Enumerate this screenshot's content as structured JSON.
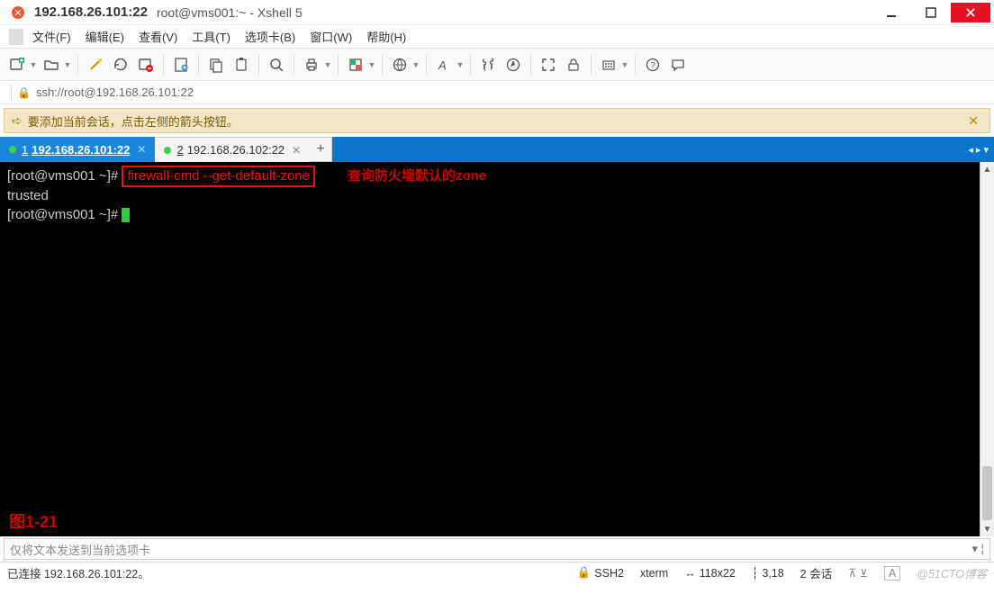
{
  "title": {
    "main": "192.168.26.101:22",
    "sub": "root@vms001:~ - Xshell 5"
  },
  "menu": {
    "file": "文件(F)",
    "edit": "编辑(E)",
    "view": "查看(V)",
    "tools": "工具(T)",
    "tabs": "选项卡(B)",
    "window": "窗口(W)",
    "help": "帮助(H)"
  },
  "address": {
    "url": "ssh://root@192.168.26.101:22"
  },
  "infobar": {
    "text": "要添加当前会话，点击左侧的箭头按钮。"
  },
  "tabs": {
    "items": [
      {
        "n": "1",
        "label": "192.168.26.101:22",
        "active": true
      },
      {
        "n": "2",
        "label": "192.168.26.102:22",
        "active": false
      }
    ],
    "add": "+"
  },
  "terminal": {
    "prompt1": "[root@vms001 ~]# ",
    "cmd": "firewall-cmd --get-default-zone",
    "annotation": "查询防火墙默认的zone",
    "output": "trusted",
    "prompt2": "[root@vms001 ~]# ",
    "figure": "图1-21"
  },
  "inputline": {
    "placeholder": "仅将文本发送到当前选项卡"
  },
  "status": {
    "conn": "已连接 192.168.26.101:22。",
    "proto": "SSH2",
    "term": "xterm",
    "size": "118x22",
    "pos": "3,18",
    "sessions": "2 会话",
    "watermark": "@51CTO博客"
  },
  "icons": {
    "proto_lock": "🔒",
    "size": "↔",
    "pos": "┆",
    "sessions_up": "▲",
    "sessions_dn": "▼",
    "caps": "A"
  }
}
